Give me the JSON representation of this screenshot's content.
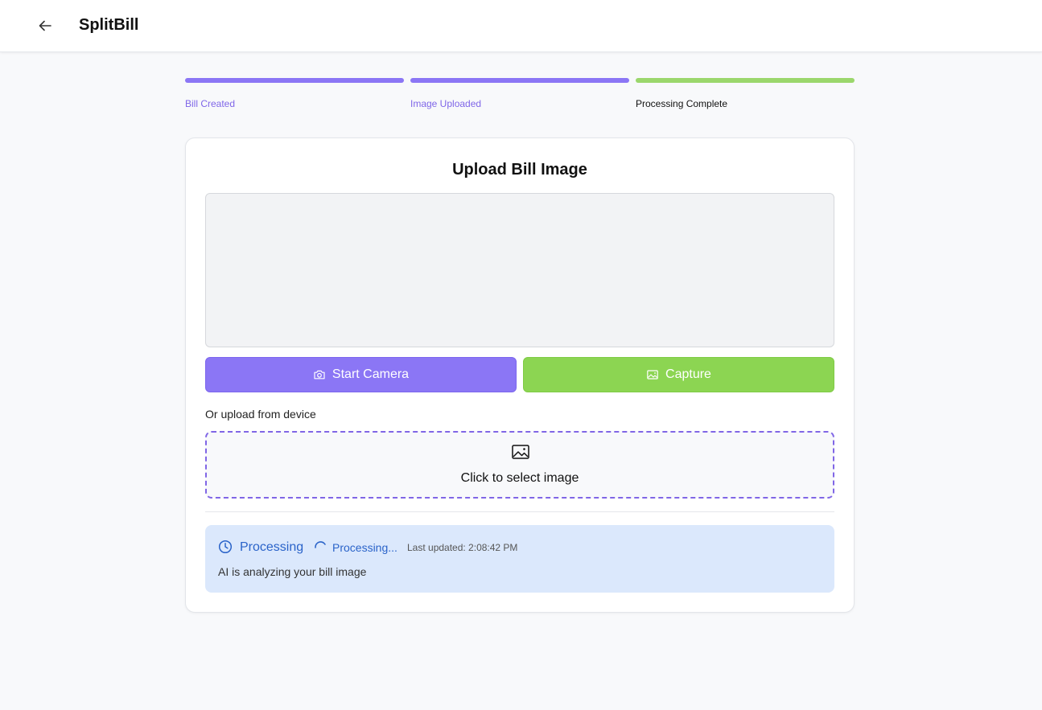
{
  "header": {
    "back_icon": "arrow-left-icon",
    "title": "SplitBill"
  },
  "steps": [
    {
      "label": "Bill Created",
      "color": "#8b76f5",
      "label_color": "#7f66e8"
    },
    {
      "label": "Image Uploaded",
      "color": "#8b76f5",
      "label_color": "#7f66e8"
    },
    {
      "label": "Processing Complete",
      "color": "#9bd76c",
      "label_color": "#111111"
    }
  ],
  "card": {
    "title": "Upload Bill Image",
    "start_camera_label": "Start Camera",
    "start_camera_icon": "camera-icon",
    "capture_label": "Capture",
    "capture_icon": "image-icon",
    "upload_label": "Or upload from device",
    "dropzone_icon": "image-icon",
    "dropzone_text": "Click to select image"
  },
  "status": {
    "icon": "clock-icon",
    "title": "Processing",
    "spinner_icon": "spinner-icon",
    "processing_text": "Processing...",
    "last_updated": "Last updated: 2:08:42 PM",
    "message": "AI is analyzing your bill image"
  },
  "colors": {
    "accent_purple": "#8b76f5",
    "accent_green": "#8cd552",
    "status_blue": "#2a63c9",
    "status_bg": "#dbe8fc"
  }
}
